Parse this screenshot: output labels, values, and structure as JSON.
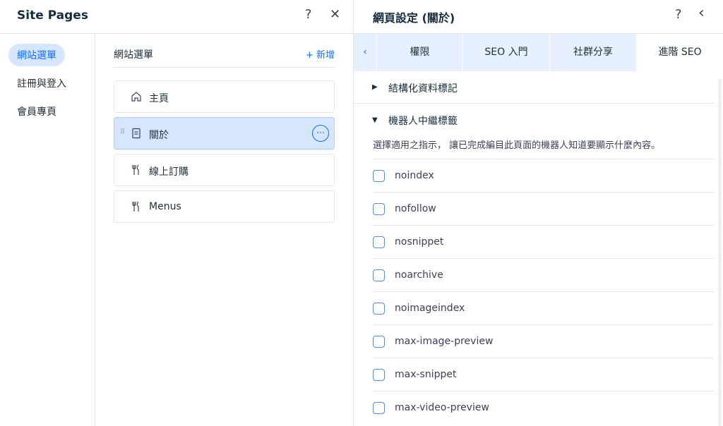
{
  "left_panel": {
    "title": "Site Pages",
    "nav": [
      {
        "label": "網站選單",
        "active": true
      },
      {
        "label": "註冊與登入",
        "active": false
      },
      {
        "label": "會員專頁",
        "active": false
      }
    ],
    "menu_heading": "網站選單",
    "add_label": "+ 新增",
    "pages": [
      {
        "label": "主頁",
        "icon": "home-icon"
      },
      {
        "label": "關於",
        "icon": "page-icon",
        "selected": true
      },
      {
        "label": "線上訂購",
        "icon": "restaurant-icon"
      },
      {
        "label": "Menus",
        "icon": "restaurant-icon"
      }
    ]
  },
  "right_panel": {
    "title": "網頁設定 (關於)",
    "tabs": [
      "權限",
      "SEO 入門",
      "社群分享",
      "進階 SEO"
    ],
    "active_tab": "進階 SEO",
    "structured_data_label": "結構化資料標記",
    "robots_label": "機器人中繼標籤",
    "robots_description": "選擇適用之指示， 讓已完成編目此頁面的機器人知道要顯示什麼內容。",
    "directives": [
      "noindex",
      "nofollow",
      "nosnippet",
      "noarchive",
      "noimageindex",
      "max-image-preview",
      "max-snippet",
      "max-video-preview"
    ]
  },
  "icons": {
    "help": "?",
    "close": "✕",
    "back": "‹",
    "more": "···",
    "drag": "⠿"
  },
  "colors": {
    "accent": "#116dff",
    "selected_bg": "#d6e6fe",
    "tabs_bg": "#e7f0ff"
  }
}
